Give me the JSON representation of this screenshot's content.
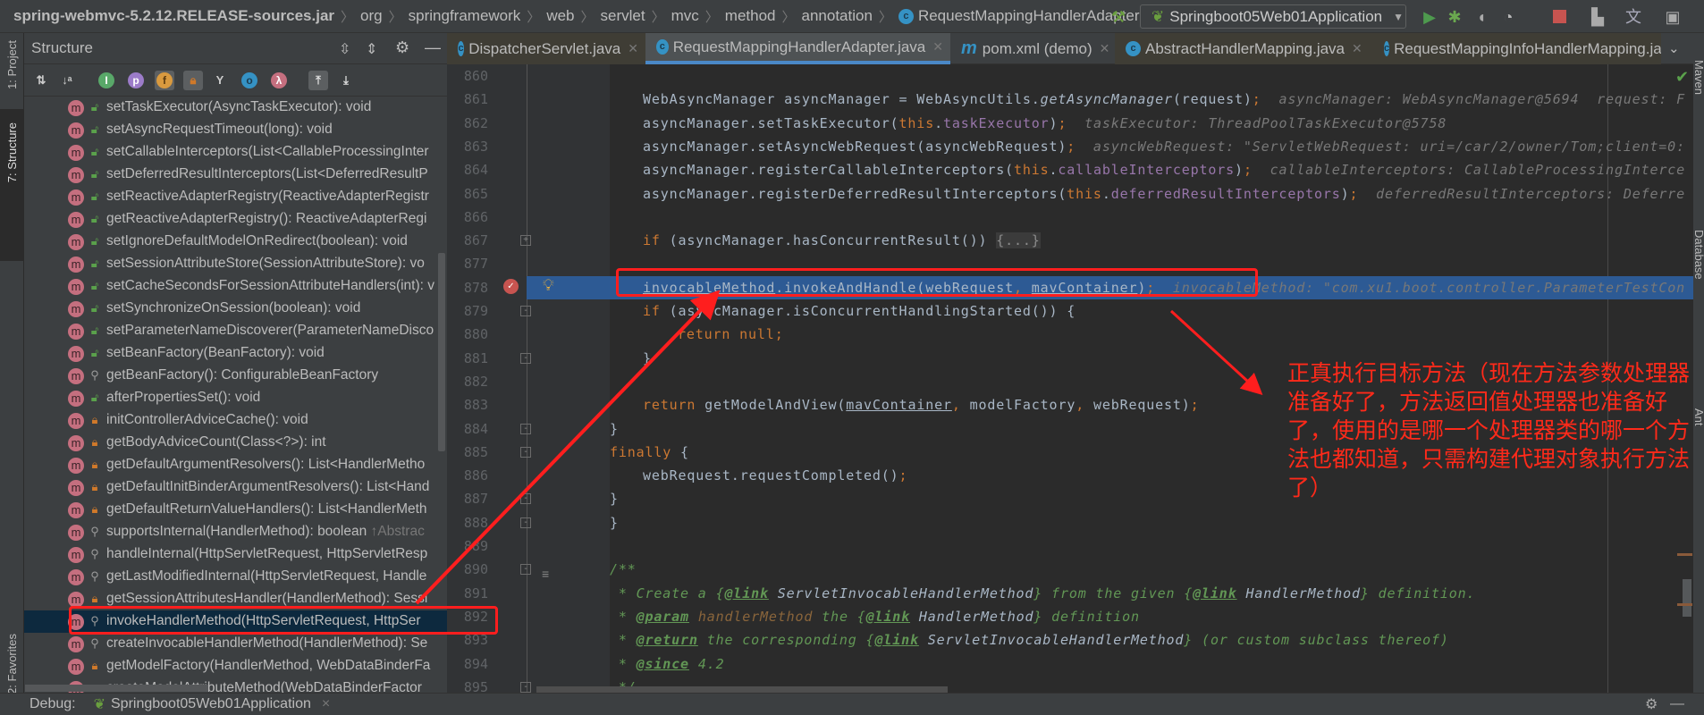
{
  "breadcrumb": [
    "spring-webmvc-5.2.12.RELEASE-sources.jar",
    "org",
    "springframework",
    "web",
    "servlet",
    "mvc",
    "method",
    "annotation",
    "RequestMappingHandlerAdapter"
  ],
  "toolbar": {
    "run_config": "Springboot05Web01Application",
    "icons": [
      "hammer-icon",
      "run-icon",
      "debug-icon",
      "coverage-icon",
      "profile-icon",
      "stop-icon",
      "project-structure-icon",
      "translate-icon"
    ]
  },
  "left_stripe": {
    "project": "1: Project",
    "structure": "7: Structure",
    "favorites": "2: Favorites"
  },
  "right_stripe": [
    "Maven",
    "Database",
    "Ant"
  ],
  "structure": {
    "title": "Structure",
    "items": [
      {
        "label": "setTaskExecutor(AsyncTaskExecutor): void",
        "vis": "public"
      },
      {
        "label": "setAsyncRequestTimeout(long): void",
        "vis": "public"
      },
      {
        "label": "setCallableInterceptors(List<CallableProcessingInter",
        "vis": "public"
      },
      {
        "label": "setDeferredResultInterceptors(List<DeferredResultP",
        "vis": "public"
      },
      {
        "label": "setReactiveAdapterRegistry(ReactiveAdapterRegistr",
        "vis": "public"
      },
      {
        "label": "getReactiveAdapterRegistry(): ReactiveAdapterRegi",
        "vis": "public"
      },
      {
        "label": "setIgnoreDefaultModelOnRedirect(boolean): void",
        "vis": "public"
      },
      {
        "label": "setSessionAttributeStore(SessionAttributeStore): vo",
        "vis": "public"
      },
      {
        "label": "setCacheSecondsForSessionAttributeHandlers(int): v",
        "vis": "public"
      },
      {
        "label": "setSynchronizeOnSession(boolean): void",
        "vis": "public"
      },
      {
        "label": "setParameterNameDiscoverer(ParameterNameDisco",
        "vis": "public"
      },
      {
        "label": "setBeanFactory(BeanFactory): void",
        "vis": "public"
      },
      {
        "label": "getBeanFactory(): ConfigurableBeanFactory",
        "vis": "protected"
      },
      {
        "label": "afterPropertiesSet(): void",
        "vis": "public"
      },
      {
        "label": "initControllerAdviceCache(): void",
        "vis": "private"
      },
      {
        "label": "getBodyAdviceCount(Class<?>): int",
        "vis": "private"
      },
      {
        "label": "getDefaultArgumentResolvers(): List<HandlerMetho",
        "vis": "private"
      },
      {
        "label": "getDefaultInitBinderArgumentResolvers(): List<Hand",
        "vis": "private"
      },
      {
        "label": "getDefaultReturnValueHandlers(): List<HandlerMeth",
        "vis": "private"
      },
      {
        "label": "supportsInternal(HandlerMethod): boolean",
        "suffix": "↑Abstrac",
        "vis": "protected"
      },
      {
        "label": "handleInternal(HttpServletRequest, HttpServletResp",
        "vis": "protected"
      },
      {
        "label": "getLastModifiedInternal(HttpServletRequest, Handle",
        "vis": "protected"
      },
      {
        "label": "getSessionAttributesHandler(HandlerMethod): Sessi",
        "vis": "private"
      },
      {
        "label": "invokeHandlerMethod(HttpServletRequest, HttpSer",
        "vis": "protected",
        "selected": true
      },
      {
        "label": "createInvocableHandlerMethod(HandlerMethod): Se",
        "vis": "protected"
      },
      {
        "label": "getModelFactory(HandlerMethod, WebDataBinderFa",
        "vis": "private"
      },
      {
        "label": "createModelAttributeMethod(WebDataBinderFactor",
        "vis": "private"
      }
    ]
  },
  "tabs": [
    {
      "label": "DispatcherServlet.java",
      "icon": "class",
      "lib": true
    },
    {
      "label": "RequestMappingHandlerAdapter.java",
      "icon": "class",
      "active": true
    },
    {
      "label": "pom.xml (demo)",
      "icon": "maven"
    },
    {
      "label": "AbstractHandlerMapping.java",
      "icon": "class",
      "lib": true
    },
    {
      "label": "RequestMappingInfoHandlerMapping.ja",
      "icon": "class",
      "lib": true
    }
  ],
  "editor": {
    "current_line": "878",
    "lines": [
      {
        "n": "860",
        "s": []
      },
      {
        "n": "861",
        "i": 3,
        "s": [
          [
            "WebAsyncManager asyncManager = WebAsyncUtils.",
            ""
          ],
          [
            "getAsyncManager",
            "it"
          ],
          [
            "(request)",
            ""
          ],
          [
            ";",
            "kw"
          ],
          [
            "  asyncManager: WebAsyncManager@5694  request: F",
            "hint"
          ]
        ]
      },
      {
        "n": "862",
        "i": 3,
        "s": [
          [
            "asyncManager.setTaskExecutor(",
            ""
          ],
          [
            "this",
            "kw"
          ],
          [
            ".",
            ""
          ],
          [
            "taskExecutor",
            "fld"
          ],
          [
            ")",
            ""
          ],
          [
            ";",
            "kw"
          ],
          [
            "  taskExecutor: ThreadPoolTaskExecutor@5758",
            "hint"
          ]
        ]
      },
      {
        "n": "863",
        "i": 3,
        "s": [
          [
            "asyncManager.setAsyncWebRequest(asyncWebRequest)",
            ""
          ],
          [
            ";",
            "kw"
          ],
          [
            "  asyncWebRequest: \"ServletWebRequest: uri=/car/2/owner/Tom;client=0:",
            "hint"
          ]
        ]
      },
      {
        "n": "864",
        "i": 3,
        "s": [
          [
            "asyncManager.registerCallableInterceptors(",
            ""
          ],
          [
            "this",
            "kw"
          ],
          [
            ".",
            ""
          ],
          [
            "callableInterceptors",
            "fld"
          ],
          [
            ")",
            ""
          ],
          [
            ";",
            "kw"
          ],
          [
            "  callableInterceptors: CallableProcessingInterce",
            "hint"
          ]
        ]
      },
      {
        "n": "865",
        "i": 3,
        "s": [
          [
            "asyncManager.registerDeferredResultInterceptors(",
            ""
          ],
          [
            "this",
            "kw"
          ],
          [
            ".",
            ""
          ],
          [
            "deferredResultInterceptors",
            "fld"
          ],
          [
            ")",
            ""
          ],
          [
            ";",
            "kw"
          ],
          [
            "  deferredResultInterceptors: Deferre",
            "hint"
          ]
        ]
      },
      {
        "n": "866",
        "s": []
      },
      {
        "n": "867",
        "i": 3,
        "fold": "plus",
        "s": [
          [
            "if",
            "kw"
          ],
          [
            " (asyncManager.hasConcurrentResult()) ",
            ""
          ],
          [
            "{...}",
            "fold"
          ]
        ]
      },
      {
        "n": "877",
        "s": []
      },
      {
        "n": "878",
        "i": 3,
        "current": true,
        "s": [
          [
            "invocableMethod",
            "ul"
          ],
          [
            ".invokeAndHandle(webRequest",
            ""
          ],
          [
            ",",
            "kw"
          ],
          [
            " ",
            ""
          ],
          [
            "mavContainer",
            "ul"
          ],
          [
            ")",
            ""
          ],
          [
            ";",
            "kw"
          ],
          [
            "  invocableMethod: \"com.xu1.boot.controller.ParameterTestCon",
            "hint"
          ]
        ]
      },
      {
        "n": "879",
        "i": 3,
        "fold": "open",
        "s": [
          [
            "if",
            "kw"
          ],
          [
            " (asyncManager.isConcurrentHandlingStarted()) {",
            ""
          ]
        ]
      },
      {
        "n": "880",
        "i": 4,
        "s": [
          [
            "return null;",
            "kw"
          ]
        ]
      },
      {
        "n": "881",
        "i": 3,
        "fold": "close",
        "s": [
          [
            "}",
            ""
          ]
        ]
      },
      {
        "n": "882",
        "s": []
      },
      {
        "n": "883",
        "i": 3,
        "s": [
          [
            "return",
            "kw"
          ],
          [
            " getModelAndView(",
            ""
          ],
          [
            "mavContainer",
            "ul"
          ],
          [
            ",",
            "kw"
          ],
          [
            " modelFactory",
            ""
          ],
          [
            ",",
            "kw"
          ],
          [
            " webRequest)",
            ""
          ],
          [
            ";",
            "kw"
          ]
        ]
      },
      {
        "n": "884",
        "i": 2,
        "fold": "close",
        "s": [
          [
            "}",
            ""
          ]
        ]
      },
      {
        "n": "885",
        "i": 2,
        "fold": "open",
        "s": [
          [
            "finally",
            "kw"
          ],
          [
            " {",
            ""
          ]
        ]
      },
      {
        "n": "886",
        "i": 3,
        "s": [
          [
            "webRequest.requestCompleted()",
            ""
          ],
          [
            ";",
            "kw"
          ]
        ]
      },
      {
        "n": "887",
        "i": 2,
        "fold": "close",
        "s": [
          [
            "}",
            ""
          ]
        ]
      },
      {
        "n": "888",
        "i": 1,
        "fold": "close",
        "s": [
          [
            "}",
            ""
          ]
        ]
      },
      {
        "n": "889",
        "s": []
      },
      {
        "n": "890",
        "i": 1,
        "fold": "open",
        "s": [
          [
            "/**",
            "cm"
          ]
        ]
      },
      {
        "n": "891",
        "i": 1,
        "s": [
          [
            " * Create a {",
            "cm"
          ],
          [
            "@link",
            "tag"
          ],
          [
            " ",
            ""
          ],
          [
            "ServletInvocableHandlerMethod",
            "ref"
          ],
          [
            "} from the given {",
            "cm"
          ],
          [
            "@link",
            "tag"
          ],
          [
            " ",
            ""
          ],
          [
            "HandlerMethod",
            "ref"
          ],
          [
            "} definition.",
            "cm"
          ]
        ]
      },
      {
        "n": "892",
        "i": 1,
        "s": [
          [
            " * ",
            "cm"
          ],
          [
            "@param",
            "tag"
          ],
          [
            " ",
            ""
          ],
          [
            "handlerMethod",
            "pn"
          ],
          [
            " the {",
            "cm"
          ],
          [
            "@link",
            "tag"
          ],
          [
            " ",
            ""
          ],
          [
            "HandlerMethod",
            "ref"
          ],
          [
            "} definition",
            "cm"
          ]
        ]
      },
      {
        "n": "893",
        "i": 1,
        "s": [
          [
            " * ",
            "cm"
          ],
          [
            "@return",
            "tag"
          ],
          [
            " the corresponding {",
            "cm"
          ],
          [
            "@link",
            "tag"
          ],
          [
            " ",
            ""
          ],
          [
            "ServletInvocableHandlerMethod",
            "ref"
          ],
          [
            "} (or custom subclass thereof)",
            "cm"
          ]
        ]
      },
      {
        "n": "894",
        "i": 1,
        "s": [
          [
            " * ",
            "cm"
          ],
          [
            "@since",
            "tag"
          ],
          [
            " 4.2",
            "cm"
          ]
        ]
      },
      {
        "n": "895",
        "i": 1,
        "fold": "close",
        "s": [
          [
            " */",
            "cm"
          ]
        ]
      }
    ]
  },
  "debug": {
    "label": "Debug:",
    "session": "Springboot05Web01Application"
  },
  "annotation": {
    "note": "正真执行目标方法（现在方法参数处理器准备好了，方法返回值处理器也准备好了，使用的是哪一个处理器类的哪一个方法也都知道，只需构建代理对象执行方法了）",
    "color": "#ff1e1e"
  },
  "colors": {
    "editor_bg": "#2b2b2b",
    "panel_bg": "#3c3f41",
    "current_line": "#2d5a94",
    "keyword": "#cc7832",
    "field": "#9876aa",
    "doc_comment": "#629755",
    "accent": "#4a88c7"
  }
}
